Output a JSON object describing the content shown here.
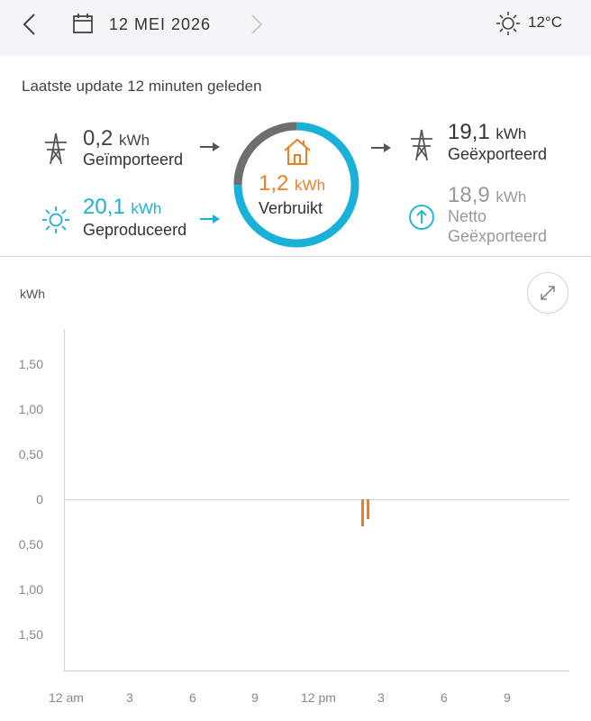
{
  "header": {
    "date": "12 MEI 2026",
    "temperature": "12°C",
    "icons": [
      "chevron-left-icon",
      "calendar-icon",
      "chevron-right-icon",
      "sun-icon"
    ]
  },
  "update_text": "Laatste update 12 minuten geleden",
  "flow": {
    "imported": {
      "value": "0,2",
      "unit": "kWh",
      "label": "Geïmporteerd"
    },
    "produced": {
      "value": "20,1",
      "unit": "kWh",
      "label": "Geproduceerd"
    },
    "consumed": {
      "value": "1,2",
      "unit": "kWh",
      "label": "Verbruikt"
    },
    "exported": {
      "value": "19,1",
      "unit": "kWh",
      "label": "Geëxporteerd"
    },
    "net": {
      "value": "18,9",
      "unit": "kWh",
      "label_line1": "Netto",
      "label_line2": "Geëxporteerd"
    }
  },
  "colors": {
    "produced": "#1ab1d9",
    "consumed": "#ef7d22",
    "grid": "#555555",
    "ring_grey": "#6e6e6e"
  },
  "chart_data": {
    "type": "bar",
    "ylabel": "kWh",
    "y_ticks": [
      "1,50",
      "1,00",
      "0,50",
      "0",
      "0,50",
      "1,00",
      "1,50"
    ],
    "x_ticks": [
      "12 am",
      "3",
      "6",
      "9",
      "12 pm",
      "3",
      "6",
      "9"
    ],
    "ylim": [
      -1.9,
      1.9
    ],
    "series": [
      {
        "values": [
          {
            "hour": 14.0,
            "value": -0.3
          },
          {
            "hour": 14.25,
            "value": -0.22
          }
        ]
      }
    ]
  }
}
